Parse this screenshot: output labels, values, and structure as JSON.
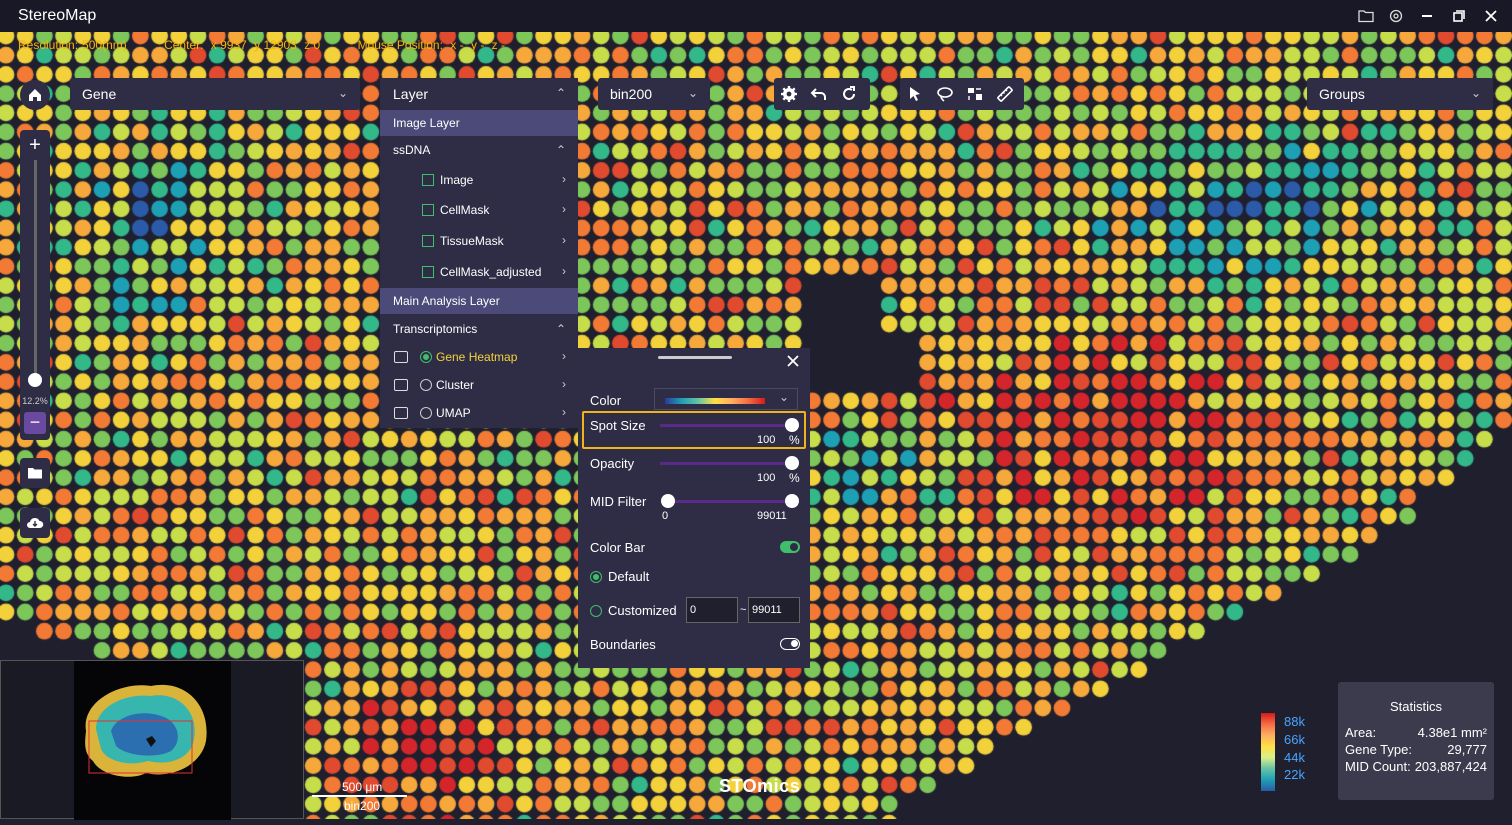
{
  "window": {
    "title": "StereoMap"
  },
  "info": {
    "resolution_label": "Resolution:",
    "resolution_value": "500(nm)",
    "center_label": "Center:",
    "center_x": "x 9937",
    "center_y": "y 12903",
    "center_z": "z 0",
    "mouse_label": "Mouse Position:",
    "mouse_x": "x -",
    "mouse_y": "y -",
    "mouse_z": "z -"
  },
  "dropdowns": {
    "gene": "Gene",
    "bin": "bin200",
    "groups": "Groups"
  },
  "zoom": {
    "level": "12.2%"
  },
  "layer_panel": {
    "title": "Layer",
    "image_layer": "Image Layer",
    "ssdna": "ssDNA",
    "items": [
      "Image",
      "CellMask",
      "TissueMask",
      "CellMask_adjusted"
    ],
    "main_analysis": "Main Analysis Layer",
    "transcriptomics": "Transcriptomics",
    "analysis_items": [
      "Gene Heatmap",
      "Cluster",
      "UMAP"
    ]
  },
  "settings": {
    "color_label": "Color",
    "spot_size_label": "Spot Size",
    "spot_size_value": "100",
    "spot_size_unit": "%",
    "opacity_label": "Opacity",
    "opacity_value": "100",
    "opacity_unit": "%",
    "mid_filter_label": "MID Filter",
    "mid_min": "0",
    "mid_max": "99011",
    "color_bar_label": "Color Bar",
    "default_label": "Default",
    "customized_label": "Customized",
    "custom_min": "0",
    "custom_sep": "~",
    "custom_max": "99011",
    "boundaries_label": "Boundaries"
  },
  "legend": {
    "labels": [
      "88k",
      "66k",
      "44k",
      "22k"
    ]
  },
  "statistics": {
    "title": "Statistics",
    "area_label": "Area:",
    "area_value": "4.38e1 mm²",
    "gene_type_label": "Gene Type:",
    "gene_type_value": "29,777",
    "mid_count_label": "MID Count:",
    "mid_count_value": "203,887,424"
  },
  "scalebar": {
    "length": "500 μm",
    "bin": "bin200"
  },
  "brand": "STOmics",
  "colors": {
    "accent": "#ffb300",
    "panel": "#2e2d45",
    "highlight": "#4b4a78",
    "green": "#3fbf6a",
    "slider": "#5a2a8a"
  }
}
